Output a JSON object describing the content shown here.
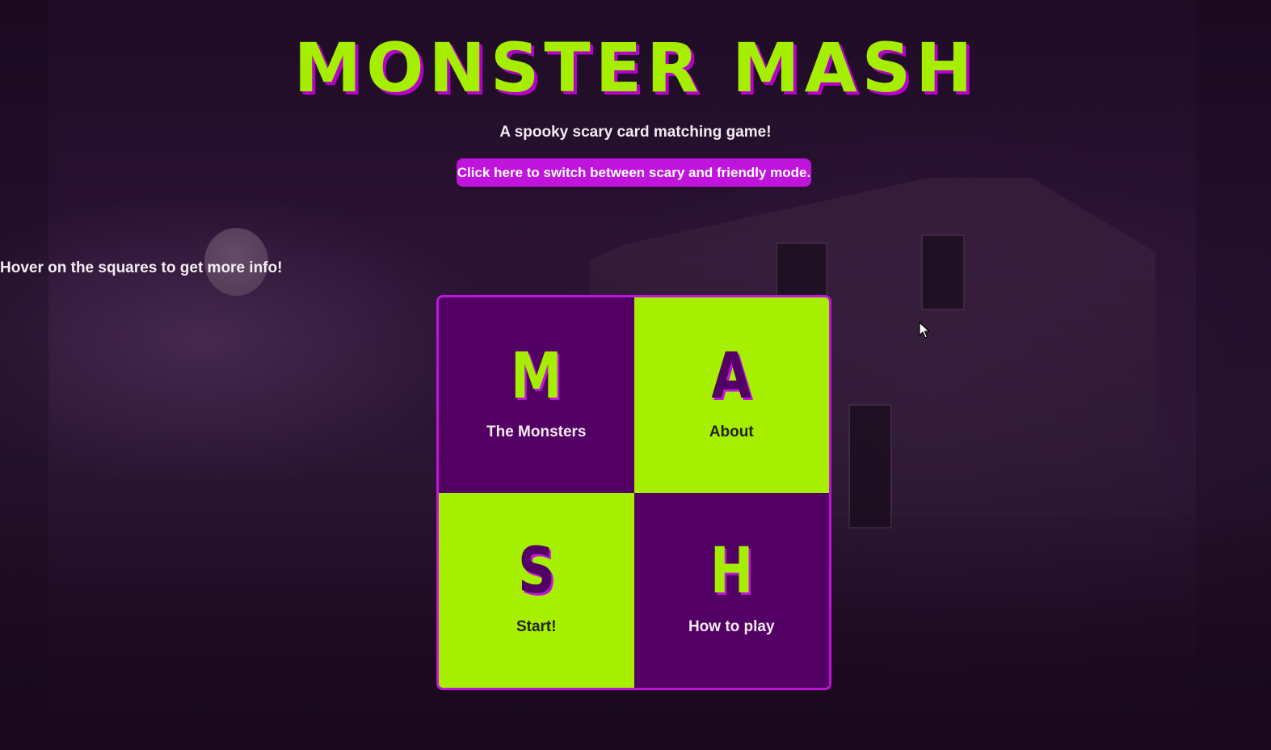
{
  "header": {
    "title": "MONSTER MASH",
    "subtitle": "A spooky scary card matching game!",
    "mode_button_label": "Click here to switch between scary and friendly mode."
  },
  "hover_hint": "Hover on the squares to get more info!",
  "tiles": [
    {
      "letter": "M",
      "label": "The Monsters",
      "style": "dark"
    },
    {
      "letter": "A",
      "label": "About",
      "style": "lime"
    },
    {
      "letter": "S",
      "label": "Start!",
      "style": "lime"
    },
    {
      "letter": "H",
      "label": "How to play",
      "style": "dark"
    }
  ],
  "colors": {
    "accent_purple": "#c014dd",
    "lime": "#a6ef00",
    "dark_tile": "#520063",
    "background": "#2a1233"
  },
  "icons": {
    "cursor": "mouse-pointer-icon",
    "moon": "moon-decoration"
  }
}
